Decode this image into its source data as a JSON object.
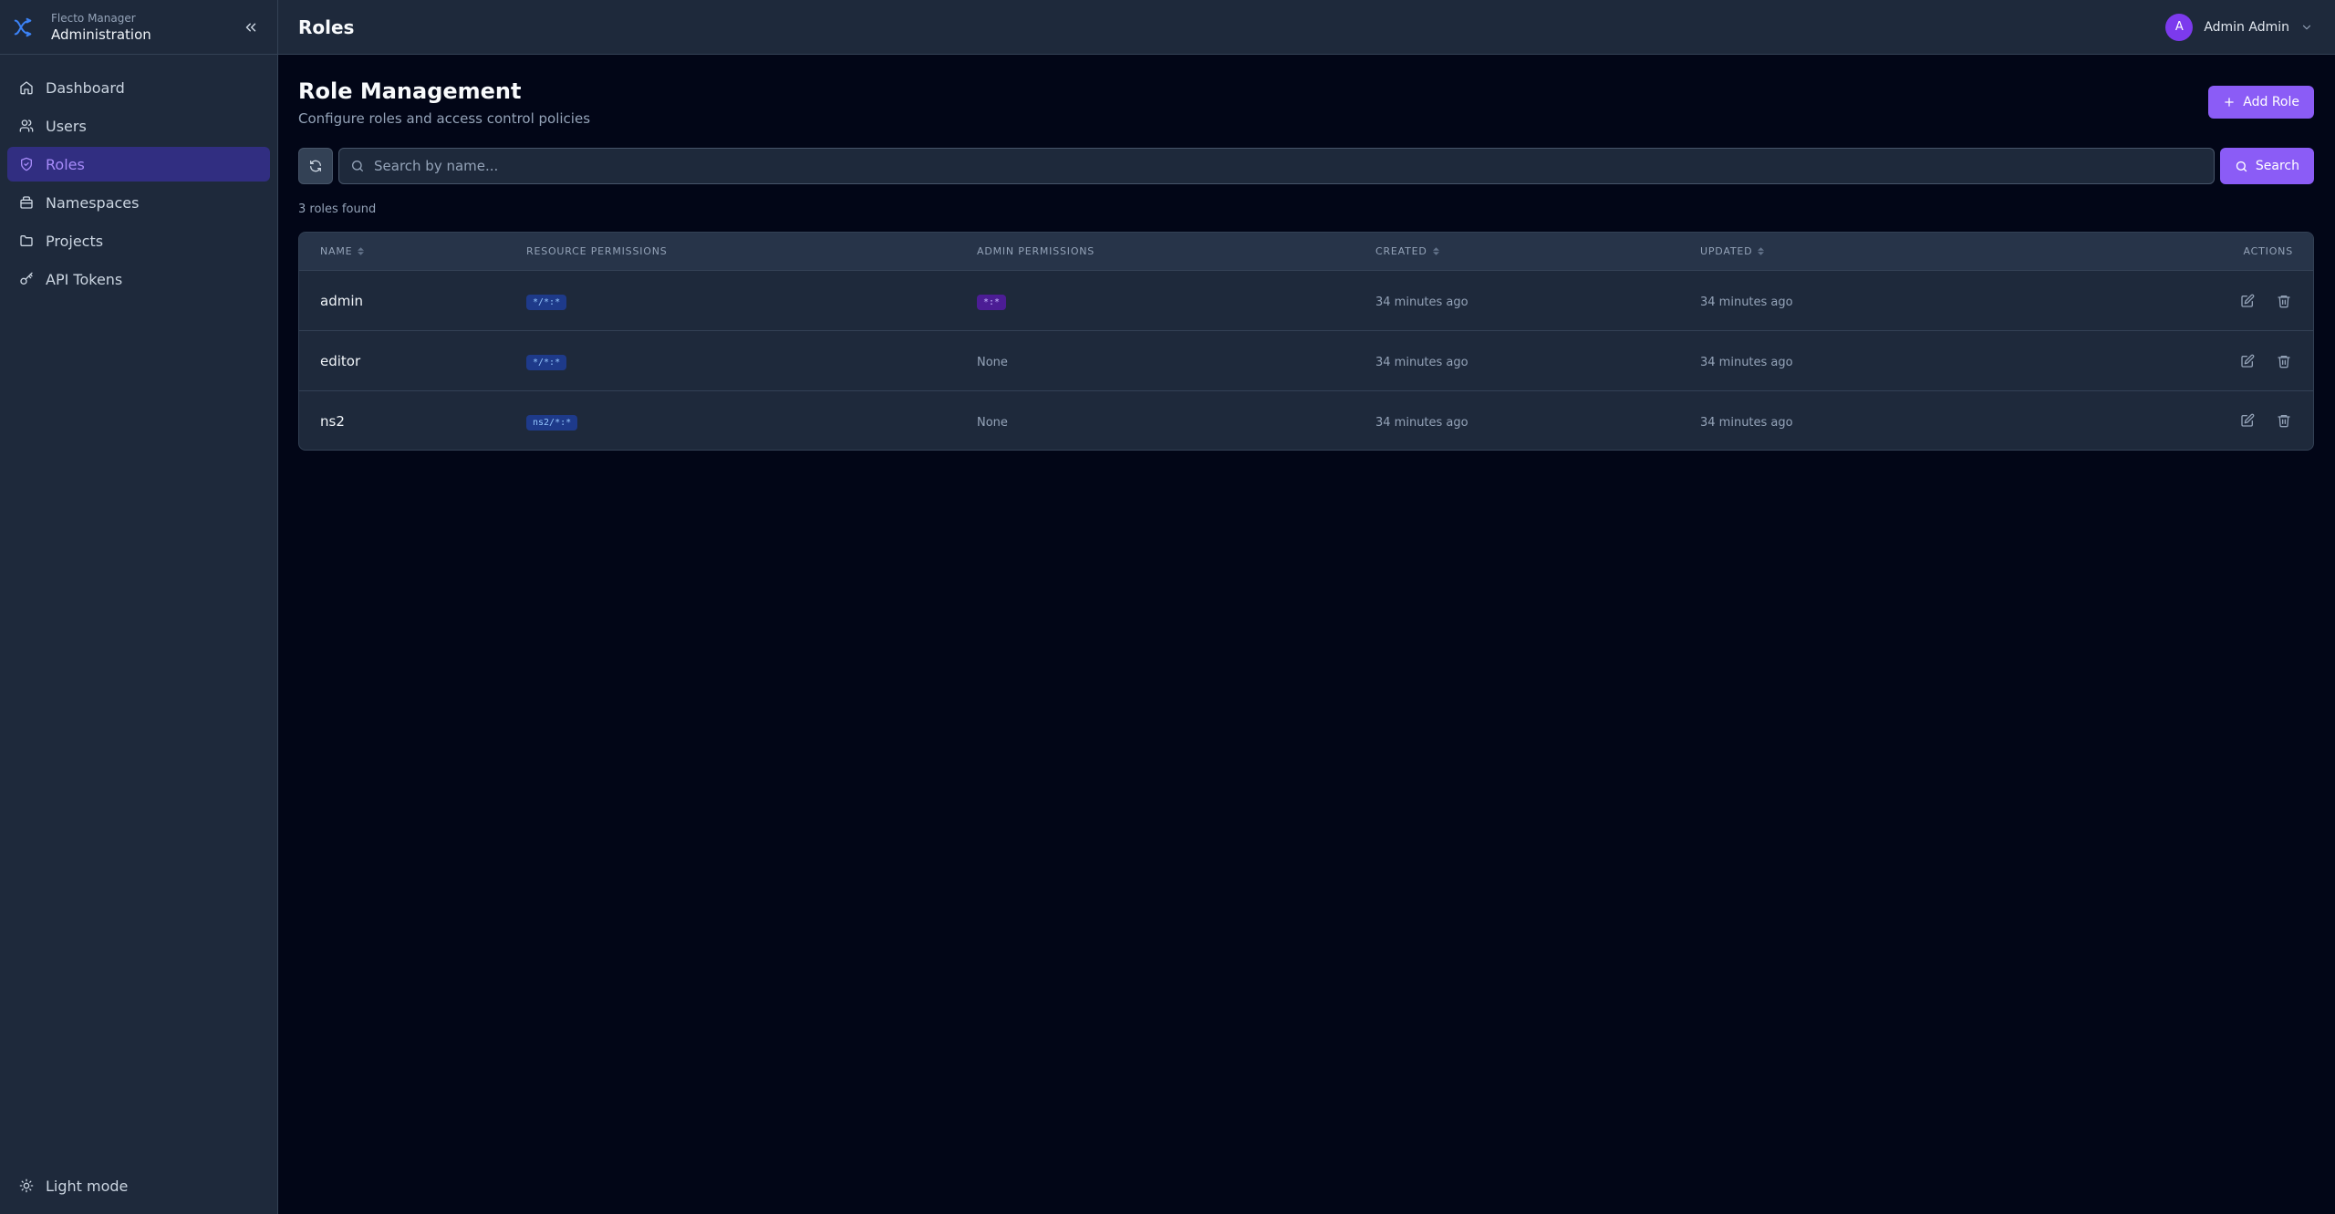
{
  "brand": {
    "subtitle": "Flecto Manager",
    "title": "Administration"
  },
  "nav": [
    {
      "label": "Dashboard",
      "icon": "home-icon"
    },
    {
      "label": "Users",
      "icon": "users-icon"
    },
    {
      "label": "Roles",
      "icon": "shield-icon",
      "active": true
    },
    {
      "label": "Namespaces",
      "icon": "box-icon"
    },
    {
      "label": "Projects",
      "icon": "folder-icon"
    },
    {
      "label": "API Tokens",
      "icon": "key-icon"
    }
  ],
  "light_mode_label": "Light mode",
  "topbar": {
    "title": "Roles",
    "user_initial": "A",
    "user_name": "Admin Admin"
  },
  "page": {
    "title": "Role Management",
    "subtitle": "Configure roles and access control policies",
    "add_label": "Add Role"
  },
  "search": {
    "placeholder": "Search by name...",
    "button_label": "Search"
  },
  "count_text": "3 roles found",
  "table": {
    "headers": {
      "name": "NAME",
      "resource": "RESOURCE PERMISSIONS",
      "admin": "ADMIN PERMISSIONS",
      "created": "CREATED",
      "updated": "UPDATED",
      "actions": "ACTIONS"
    },
    "rows": [
      {
        "name": "admin",
        "resource": "*/*:*",
        "admin": "*:*",
        "admin_is_chip": true,
        "created": "34 minutes ago",
        "updated": "34 minutes ago"
      },
      {
        "name": "editor",
        "resource": "*/*:*",
        "admin": "None",
        "admin_is_chip": false,
        "created": "34 minutes ago",
        "updated": "34 minutes ago"
      },
      {
        "name": "ns2",
        "resource": "ns2/*:*",
        "admin": "None",
        "admin_is_chip": false,
        "created": "34 minutes ago",
        "updated": "34 minutes ago"
      }
    ]
  },
  "colors": {
    "accent": "#8b5cf6",
    "background": "#020617",
    "panel": "#1e293b"
  }
}
